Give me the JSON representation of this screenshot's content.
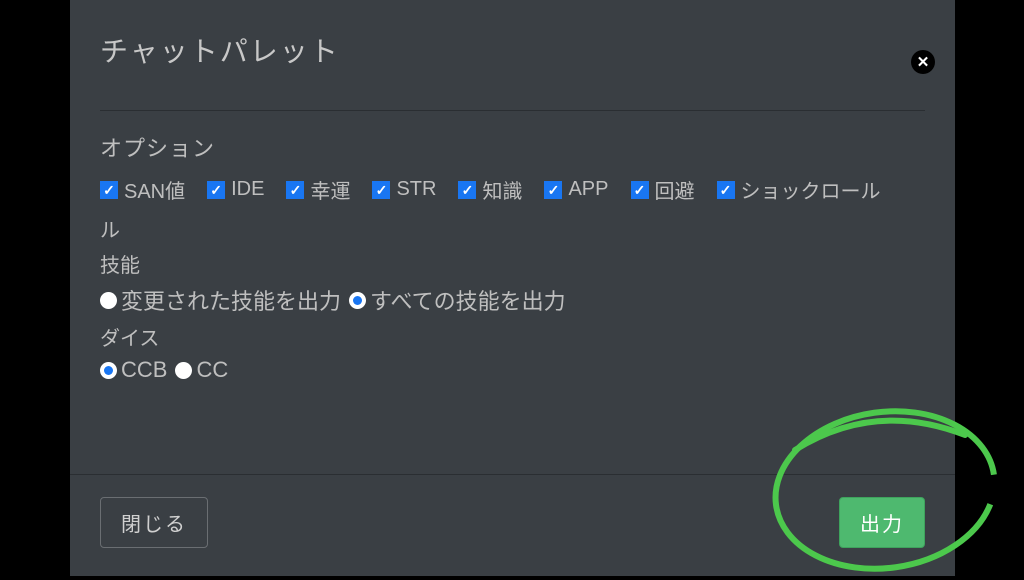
{
  "modal": {
    "title": "チャットパレット"
  },
  "options": {
    "section_label": "オプション",
    "checks": [
      {
        "label": "SAN値"
      },
      {
        "label": "IDE"
      },
      {
        "label": "幸運"
      },
      {
        "label": "STR"
      },
      {
        "label": "知識"
      },
      {
        "label": "APP"
      },
      {
        "label": "回避"
      },
      {
        "label": "ショックロール"
      }
    ],
    "wrap_tail": "ル"
  },
  "skills": {
    "label": "技能",
    "radios": [
      {
        "label": "変更された技能を出力",
        "selected": false
      },
      {
        "label": "すべての技能を出力",
        "selected": true
      }
    ]
  },
  "dice": {
    "label": "ダイス",
    "radios": [
      {
        "label": "CCB",
        "selected": true
      },
      {
        "label": "CC",
        "selected": false
      }
    ]
  },
  "footer": {
    "close_label": "閉じる",
    "output_label": "出力"
  }
}
